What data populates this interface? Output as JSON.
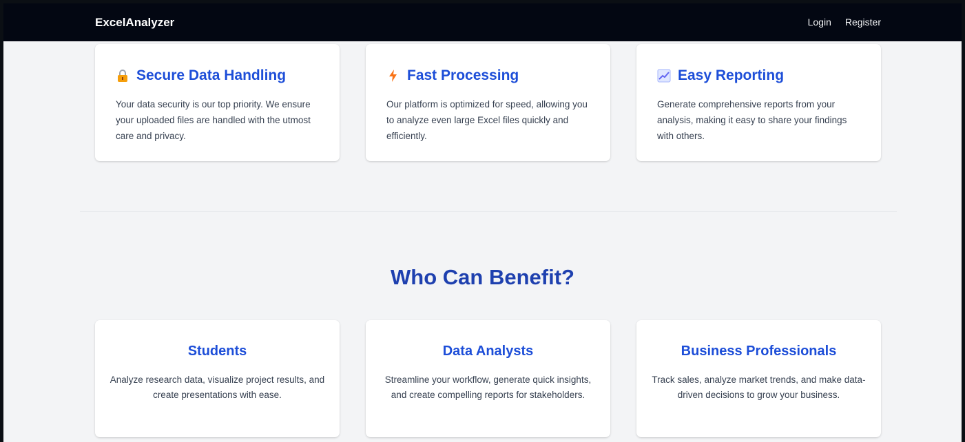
{
  "nav": {
    "brand": "ExcelAnalyzer",
    "login": "Login",
    "register": "Register"
  },
  "features": [
    {
      "icon": "lock-icon",
      "title": "Secure Data Handling",
      "description": "Your data security is our top priority. We ensure your uploaded files are handled with the utmost care and privacy."
    },
    {
      "icon": "lightning-icon",
      "title": "Fast Processing",
      "description": "Our platform is optimized for speed, allowing you to analyze even large Excel files quickly and efficiently."
    },
    {
      "icon": "chart-icon",
      "title": "Easy Reporting",
      "description": "Generate comprehensive reports from your analysis, making it easy to share your findings with others."
    }
  ],
  "benefit_section": {
    "heading": "Who Can Benefit?",
    "cards": [
      {
        "title": "Students",
        "description": "Analyze research data, visualize project results, and create presentations with ease."
      },
      {
        "title": "Data Analysts",
        "description": "Streamline your workflow, generate quick insights, and create compelling reports for stakeholders."
      },
      {
        "title": "Business Professionals",
        "description": "Track sales, analyze market trends, and make data-driven decisions to grow your business."
      }
    ]
  },
  "colors": {
    "navbar_bg": "#030712",
    "page_bg": "#f3f4f6",
    "accent": "#1d4ed8",
    "heading": "#1e40af"
  }
}
